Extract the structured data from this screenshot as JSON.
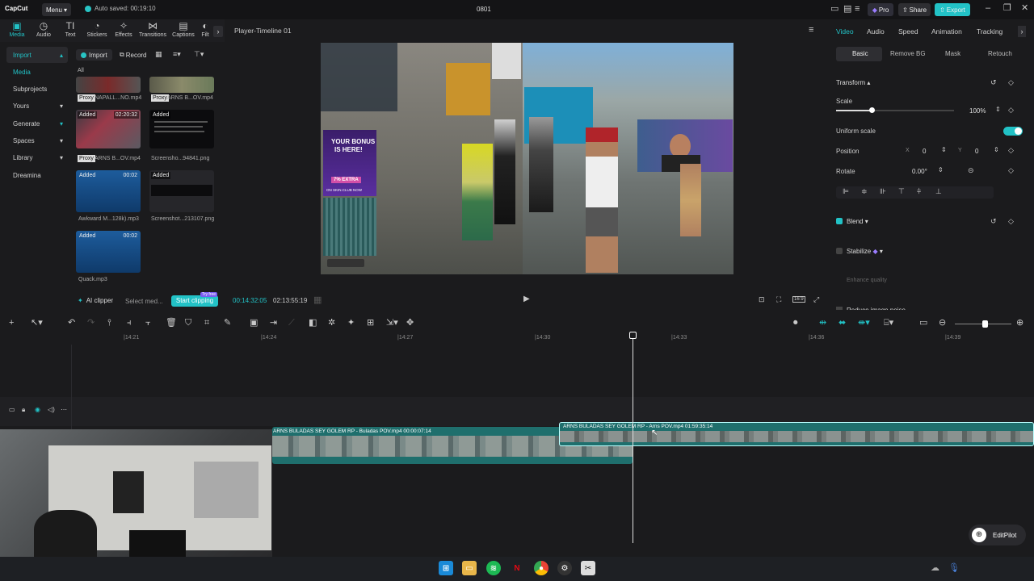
{
  "app": {
    "logo": "CapCut",
    "menu": "Menu",
    "autosave": "Auto saved: 00:19:10",
    "title": "0801"
  },
  "titlebar": {
    "pro": "Pro",
    "share": "Share",
    "export": "Export"
  },
  "tools": [
    {
      "label": "Media",
      "icon": "media-icon"
    },
    {
      "label": "Audio",
      "icon": "audio-icon"
    },
    {
      "label": "Text",
      "icon": "text-icon"
    },
    {
      "label": "Stickers",
      "icon": "stickers-icon"
    },
    {
      "label": "Effects",
      "icon": "effects-icon"
    },
    {
      "label": "Transitions",
      "icon": "transitions-icon"
    },
    {
      "label": "Captions",
      "icon": "captions-icon"
    },
    {
      "label": "Filt",
      "icon": "filters-icon"
    }
  ],
  "leftnav": {
    "import": "Import",
    "media": "Media",
    "subprojects": "Subprojects",
    "yours": "Yours",
    "generate": "Generate",
    "spaces": "Spaces",
    "library": "Library",
    "dreamina": "Dreamina"
  },
  "media": {
    "import_btn": "Import",
    "record_btn": "Record",
    "filter_all": "All",
    "proxy": "Proxy",
    "added": "Added",
    "items": [
      {
        "name": "NAPALL...NO.mp4"
      },
      {
        "name": "ARNS B...OV.mp4"
      },
      {
        "name": "ARNS B...OV.mp4",
        "duration": "02:20:32"
      },
      {
        "name": "Screensho...94841.png"
      },
      {
        "name": "Awkward M...128k).mp3",
        "duration": "00:02"
      },
      {
        "name": "Screenshot...213107.png"
      },
      {
        "name": "Quack.mp3",
        "duration": "00:02"
      }
    ],
    "ai_clipper": "AI clipper",
    "select_media": "Select med...",
    "start_clipping": "Start clipping",
    "try_free": "Try free"
  },
  "player": {
    "title": "Player-Timeline 01",
    "current_time": "00:14:32:05",
    "total_time": "02:13:55:19",
    "ratio_icon": "16:9",
    "overlay": {
      "bonus_line1": "YOUR BONUS",
      "bonus_line2": "IS HERE!",
      "bonus_pct": "7% EXTRA",
      "bonus_site": "ON SKIN.CLUB NOW"
    }
  },
  "right": {
    "tabs": [
      "Video",
      "Audio",
      "Speed",
      "Animation",
      "Tracking"
    ],
    "subtabs": [
      "Basic",
      "Remove BG",
      "Mask",
      "Retouch"
    ],
    "transform": "Transform",
    "scale": "Scale",
    "scale_value": "100%",
    "scale_level_pct": 30,
    "uniform_scale": "Uniform scale",
    "position": "Position",
    "x_label": "X",
    "x_value": "0",
    "y_label": "Y",
    "y_value": "0",
    "rotate": "Rotate",
    "rotate_value": "0.00°",
    "blend": "Blend",
    "stabilize": "Stabilize",
    "enhance_quality": "Enhance quality",
    "reduce_noise": "Reduce image noise"
  },
  "ruler": [
    "|14:21",
    "|14:24",
    "|14:27",
    "|14:30",
    "|14:33",
    "|14:36",
    "|14:39"
  ],
  "clips": {
    "clip1": "ARNS BULADAS SEY GOLEM RP - Buladas POV.mp4  00:00:07:14",
    "clip2": "ARNS BULADAS SEY GOLEM RP - Arns POV.mp4  01:59:35:14"
  },
  "editpilot": "EditPilot",
  "colors": {
    "accent": "#22c2c6",
    "bg": "#1b1b1d",
    "clip": "#1f6f6d"
  }
}
